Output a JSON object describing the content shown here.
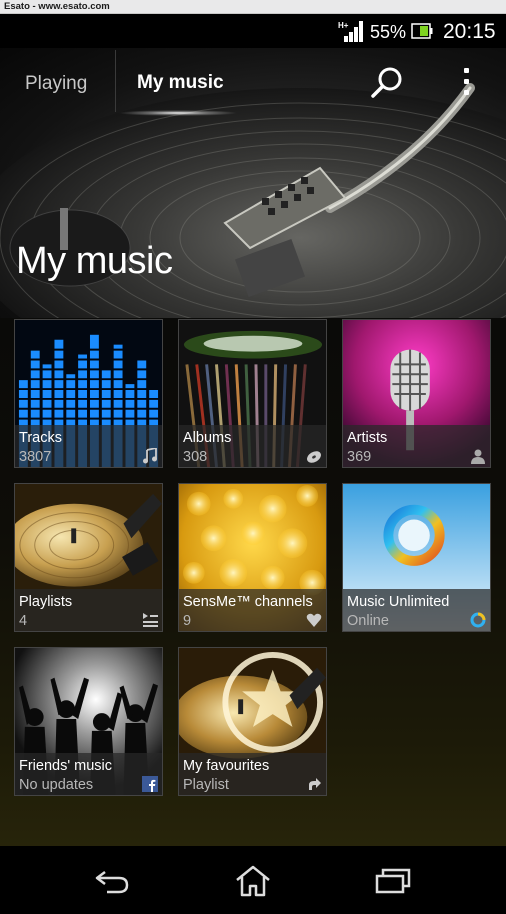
{
  "watermark": "Esato - www.esato.com",
  "status_bar": {
    "network": "H+",
    "battery_percent": "55%",
    "time": "20:15"
  },
  "tabs": [
    {
      "label": "Playing",
      "active": false
    },
    {
      "label": "My music",
      "active": true
    }
  ],
  "hero_title": "My music",
  "tiles": [
    {
      "title": "Tracks",
      "subtitle": "3807",
      "icon": "music-note-icon"
    },
    {
      "title": "Albums",
      "subtitle": "308",
      "icon": "disc-icon"
    },
    {
      "title": "Artists",
      "subtitle": "369",
      "icon": "person-icon"
    },
    {
      "title": "Playlists",
      "subtitle": "4",
      "icon": "playlist-icon"
    },
    {
      "title": "SensMe™ channels",
      "subtitle": "9",
      "icon": "heart-icon"
    },
    {
      "title": "Music Unlimited",
      "subtitle": "Online",
      "icon": "music-unlimited-icon"
    },
    {
      "title": "Friends' music",
      "subtitle": "No updates",
      "icon": "facebook-icon"
    },
    {
      "title": "My favourites",
      "subtitle": "Playlist",
      "icon": "shortcut-arrow-icon"
    }
  ],
  "colors": {
    "accent": "#ffffff",
    "background": "#000000",
    "caption_overlay": "#282828"
  }
}
